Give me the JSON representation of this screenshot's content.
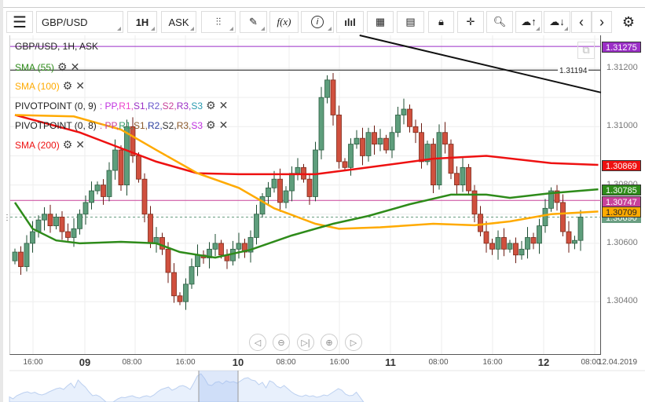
{
  "toolbar": {
    "symbol": "GBP/USD",
    "timeframe": "1H",
    "price_type": "ASK",
    "fx_label": "f(x)",
    "buttons": [
      "menu",
      "chart-type",
      "draw",
      "indicators",
      "info",
      "volume",
      "calendar",
      "report",
      "lock",
      "crosshair",
      "zoom-chart",
      "upload",
      "download",
      "prev",
      "next",
      "settings"
    ]
  },
  "legend": {
    "title": "GBP/USD, 1H, ASK",
    "sma55": "SMA (55)",
    "sma100": "SMA (100)",
    "pivot1": "PIVOTPOINT (0, 9)",
    "pivot1_levels": [
      ": PP,",
      " R1,",
      " S1,",
      " R2,",
      " S2,",
      " R3,",
      " S3"
    ],
    "pivot2": "PIVOTPOINT (0, 8)",
    "pivot2_levels": [
      ": PP,",
      " R1,",
      " S1,",
      " R2,",
      " S2,",
      " R3,",
      " S3"
    ],
    "sma200": "SMA (200)"
  },
  "colors": {
    "up": "#5e9e7c",
    "down": "#d0503e",
    "sma55": "#2e8b1a",
    "sma100": "#ffaa00",
    "sma200": "#ee1111",
    "purple": "#9b2fc6",
    "magenta": "#c8429a"
  },
  "price_axis": {
    "labels": [
      "1.31200",
      "1.31000",
      "1.30800",
      "1.30600",
      "1.30400"
    ],
    "values": [
      1.312,
      1.31,
      1.308,
      1.306,
      1.304
    ]
  },
  "price_tags": {
    "purple": "1.31275",
    "sma200": "1.30869",
    "sma55": "1.30785",
    "magenta": "1.30747",
    "sma100": "1.30709",
    "last": "1.30690"
  },
  "measure_label": "1.31194",
  "time_axis": [
    {
      "t": "16:00",
      "b": false
    },
    {
      "t": "09",
      "b": true
    },
    {
      "t": "08:00",
      "b": false
    },
    {
      "t": "16:00",
      "b": false
    },
    {
      "t": "10",
      "b": true
    },
    {
      "t": "08:00",
      "b": false
    },
    {
      "t": "16:00",
      "b": false
    },
    {
      "t": "11",
      "b": true
    },
    {
      "t": "08:00",
      "b": false
    },
    {
      "t": "16:00",
      "b": false
    },
    {
      "t": "12",
      "b": true
    },
    {
      "t": "08:00",
      "b": false
    }
  ],
  "date_label": "12.04.2019",
  "chart_data": {
    "type": "candlestick",
    "first_open": 1.3054,
    "closes": [
      1.3057,
      1.3052,
      1.306,
      1.3064,
      1.3068,
      1.307,
      1.3066,
      1.3069,
      1.3064,
      1.3062,
      1.3065,
      1.307,
      1.3074,
      1.3078,
      1.308,
      1.3076,
      1.3085,
      1.3092,
      1.308,
      1.31,
      1.309,
      1.3082,
      1.307,
      1.306,
      1.3062,
      1.3058,
      1.305,
      1.3042,
      1.304,
      1.3046,
      1.3052,
      1.3056,
      1.3055,
      1.3058,
      1.306,
      1.3056,
      1.3054,
      1.3058,
      1.306,
      1.3057,
      1.3062,
      1.307,
      1.3076,
      1.3079,
      1.3082,
      1.3074,
      1.3078,
      1.3084,
      1.3086,
      1.3082,
      1.3076,
      1.3092,
      1.311,
      1.3116,
      1.3104,
      1.3088,
      1.3086,
      1.3094,
      1.3096,
      1.309,
      1.3098,
      1.3094,
      1.3096,
      1.3092,
      1.3098,
      1.3104,
      1.3106,
      1.31,
      1.3098,
      1.3088,
      1.3094,
      1.308,
      1.3098,
      1.3094,
      1.3084,
      1.308,
      1.3086,
      1.3078,
      1.307,
      1.3064,
      1.306,
      1.3058,
      1.3062,
      1.3058,
      1.306,
      1.3056,
      1.3058,
      1.3062,
      1.306,
      1.3066,
      1.3072,
      1.3078,
      1.3074,
      1.3064,
      1.306,
      1.3061,
      1.3069
    ],
    "sma200": [
      [
        0,
        1.3104
      ],
      [
        11,
        1.3098
      ],
      [
        24,
        1.3088
      ],
      [
        31,
        1.3084
      ],
      [
        38,
        1.30837
      ],
      [
        51,
        1.30837
      ],
      [
        58,
        1.30855
      ],
      [
        71,
        1.3089
      ],
      [
        80,
        1.309
      ],
      [
        91,
        1.30875
      ],
      [
        99,
        1.30869
      ]
    ],
    "sma100": [
      [
        0,
        1.3104
      ],
      [
        10,
        1.31035
      ],
      [
        18,
        1.3099
      ],
      [
        24,
        1.3092
      ],
      [
        31,
        1.3084
      ],
      [
        38,
        1.3079
      ],
      [
        44,
        1.3072
      ],
      [
        51,
        1.30667
      ],
      [
        55,
        1.3065
      ],
      [
        62,
        1.30655
      ],
      [
        71,
        1.30667
      ],
      [
        78,
        1.30662
      ],
      [
        84,
        1.30675
      ],
      [
        91,
        1.307
      ],
      [
        99,
        1.30709
      ]
    ],
    "sma55": [
      [
        0,
        1.3074
      ],
      [
        3,
        1.3065
      ],
      [
        7,
        1.3061
      ],
      [
        11,
        1.306
      ],
      [
        18,
        1.30605
      ],
      [
        24,
        1.306
      ],
      [
        28,
        1.3057
      ],
      [
        34,
        1.30551
      ],
      [
        40,
        1.30578
      ],
      [
        47,
        1.30627
      ],
      [
        54,
        1.30667
      ],
      [
        60,
        1.30694
      ],
      [
        67,
        1.30734
      ],
      [
        74,
        1.30767
      ],
      [
        80,
        1.30767
      ],
      [
        84,
        1.30756
      ],
      [
        91,
        1.30772
      ],
      [
        99,
        1.30785
      ]
    ],
    "trendline": [
      [
        58.5,
        1.31313
      ],
      [
        100,
        1.31117
      ]
    ],
    "hlines": {
      "purple": 1.31275,
      "magenta": 1.30747,
      "last": 1.3069,
      "measure": 1.31194
    },
    "ylim": [
      1.303,
      1.3137
    ]
  }
}
